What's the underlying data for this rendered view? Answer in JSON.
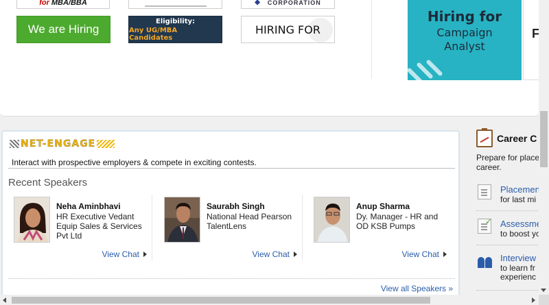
{
  "jobs": {
    "banners": {
      "mba": {
        "part1": "for",
        "part2": "MBA/BBA"
      },
      "corp": "CORPORATION",
      "hiring": "We are Hiring",
      "elig_title": "Eligibility:",
      "elig_sub": "Any UG/MBA Candidates",
      "hiring_for": "HIRING FOR"
    },
    "campaign": {
      "line1": "Hiring for",
      "line2": "Campaign",
      "line3": "Analyst"
    },
    "next_card_letter": "F"
  },
  "engage": {
    "logo": "NET-ENGAGE",
    "tagline": "Interact with prospective employers & compete in exciting contests.",
    "recent_title": "Recent Speakers",
    "speakers": [
      {
        "name": "Neha Aminbhavi",
        "role": "HR Executive Vedant Equip Sales & Services Pvt Ltd",
        "chat": "View Chat"
      },
      {
        "name": "Saurabh Singh",
        "role": "National Head Pearson TalentLens",
        "chat": "View Chat"
      },
      {
        "name": "Anup Sharma",
        "role": "Dy. Manager - HR and OD KSB Pumps",
        "chat": "View Chat"
      }
    ],
    "view_all": "View all Speakers »"
  },
  "career": {
    "title": "Career C",
    "intro_line1": "Prepare for place",
    "intro_line2": "career.",
    "items": [
      {
        "link": "Placemen",
        "sub": "for last mi"
      },
      {
        "link": "Assessme",
        "sub": "to boost yo"
      },
      {
        "link": "Interview",
        "sub1": "to learn fr",
        "sub2": "experienc"
      }
    ]
  },
  "colors": {
    "brand_green": "#4caa2e",
    "navy": "#21384f",
    "teal": "#27b3c3",
    "link_blue": "#2a5caa",
    "logo_yellow": "#f0b400"
  }
}
